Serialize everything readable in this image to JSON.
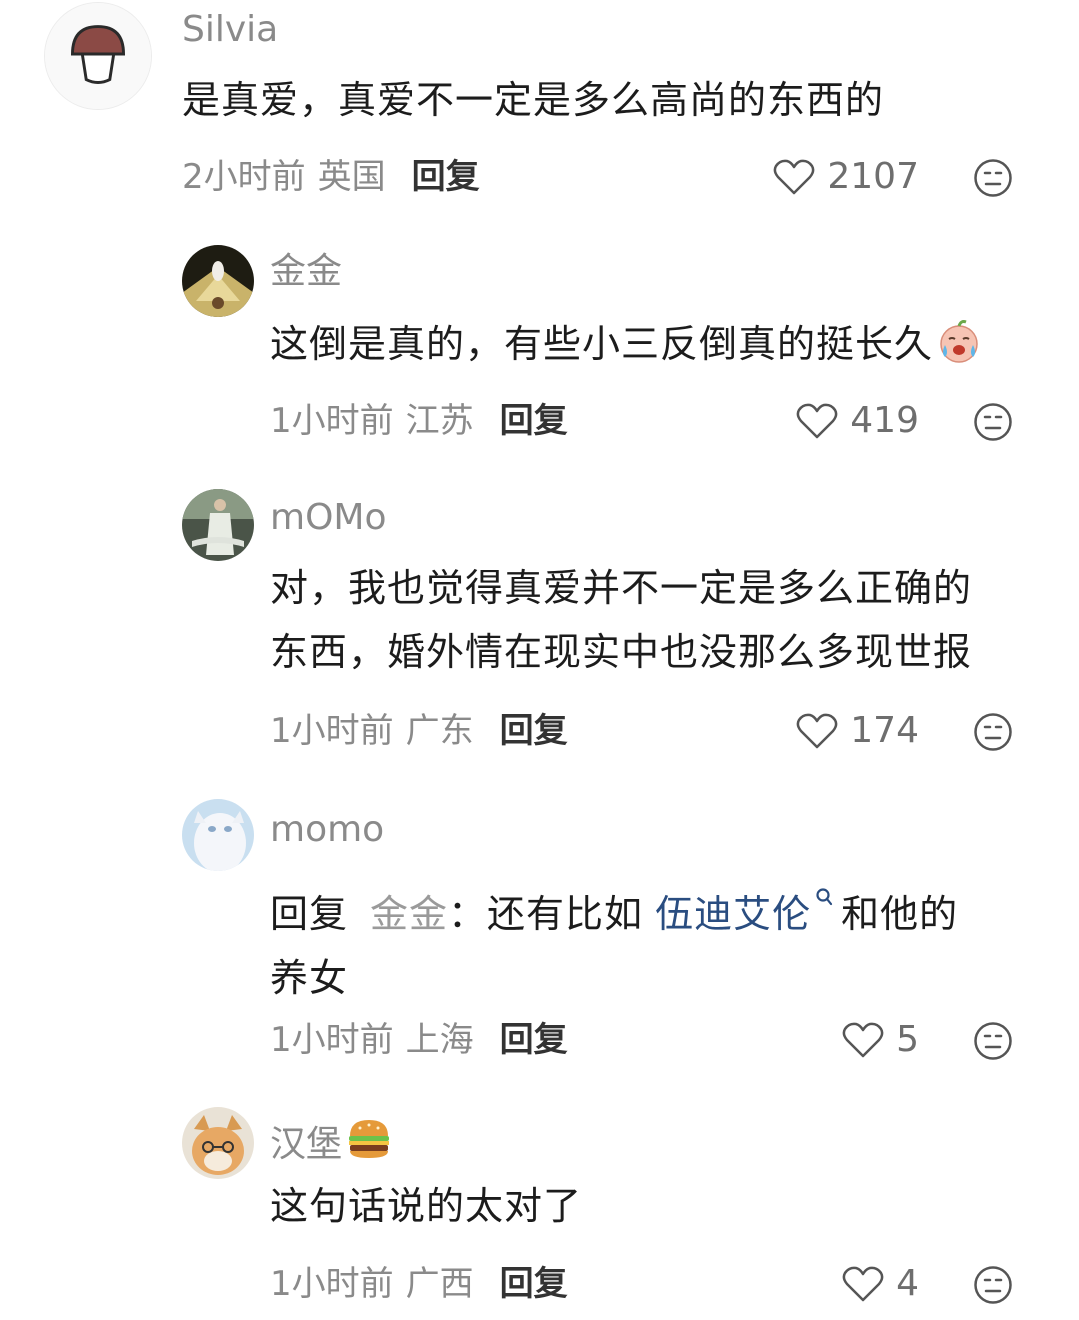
{
  "comments": [
    {
      "username": "Silvia",
      "text": "是真爱，真爱不一定是多么高尚的东西的",
      "time": "2小时前",
      "location": "英国",
      "reply_label": "回复",
      "likes": "2107",
      "avatar_icon": "mushroom-icon"
    },
    {
      "username": "金金",
      "text": "这倒是真的，有些小三反倒真的挺长久",
      "emoji": "crying-face-emoji",
      "time": "1小时前",
      "location": "江苏",
      "reply_label": "回复",
      "likes": "419"
    },
    {
      "username": "mOMo",
      "text_line1": "对，我也觉得真爱并不一定是多么正确的",
      "text_line2": "东西，婚外情在现实中也没那么多现世报",
      "time": "1小时前",
      "location": "广东",
      "reply_label": "回复",
      "likes": "174"
    },
    {
      "username": "momo",
      "reply_prefix": "回复",
      "reply_target": "金金",
      "colon": "：",
      "text_before": "还有比如",
      "link": "伍迪艾伦",
      "text_after": "和他的",
      "text_line2": "养女",
      "time": "1小时前",
      "location": "上海",
      "reply_label": "回复",
      "likes": "5"
    },
    {
      "username": "汉堡",
      "username_emoji": "hamburger-emoji",
      "text": "这句话说的太对了",
      "time": "1小时前",
      "location": "广西",
      "reply_label": "回复",
      "likes": "4"
    }
  ],
  "colors": {
    "username": "#8a8a8a",
    "text": "#1c1c1c",
    "link": "#2a4d80",
    "meta": "#8a8a8a"
  }
}
